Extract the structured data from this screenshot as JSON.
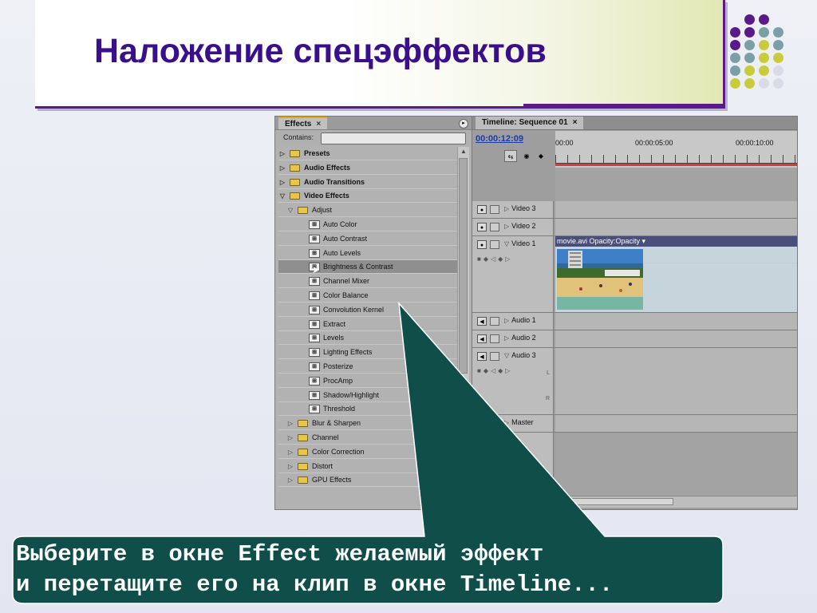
{
  "slide": {
    "title": "Наложение спецэффектов",
    "caption_line1": "Выберите в окне Effect желаемый эффект",
    "caption_line2": "и перетащите его на клип в окне Timeline...",
    "colors": {
      "title": "#3a0f8c",
      "accent": "#5a1a8a",
      "callout": "#0f4e49"
    }
  },
  "effects_panel": {
    "tab_label": "Effects",
    "close_glyph": "×",
    "contains_label": "Contains:",
    "contains_value": "",
    "tree": [
      {
        "label": "Presets",
        "kind": "folder",
        "level": 0,
        "bold": true,
        "expanded": false
      },
      {
        "label": "Audio Effects",
        "kind": "folder",
        "level": 0,
        "bold": true,
        "expanded": false
      },
      {
        "label": "Audio Transitions",
        "kind": "folder",
        "level": 0,
        "bold": true,
        "expanded": false
      },
      {
        "label": "Video Effects",
        "kind": "folder",
        "level": 0,
        "bold": true,
        "expanded": true
      },
      {
        "label": "Adjust",
        "kind": "folder",
        "level": 1,
        "bold": false,
        "expanded": true
      },
      {
        "label": "Auto Color",
        "kind": "effect",
        "level": 2
      },
      {
        "label": "Auto Contrast",
        "kind": "effect",
        "level": 2
      },
      {
        "label": "Auto Levels",
        "kind": "effect",
        "level": 2
      },
      {
        "label": "Brightness & Contrast",
        "kind": "effect",
        "level": 2,
        "selected": true
      },
      {
        "label": "Channel Mixer",
        "kind": "effect",
        "level": 2
      },
      {
        "label": "Color Balance",
        "kind": "effect",
        "level": 2
      },
      {
        "label": "Convolution Kernel",
        "kind": "effect",
        "level": 2
      },
      {
        "label": "Extract",
        "kind": "effect",
        "level": 2
      },
      {
        "label": "Levels",
        "kind": "effect",
        "level": 2
      },
      {
        "label": "Lighting Effects",
        "kind": "effect",
        "level": 2
      },
      {
        "label": "Posterize",
        "kind": "effect",
        "level": 2
      },
      {
        "label": "ProcAmp",
        "kind": "effect",
        "level": 2
      },
      {
        "label": "Shadow/Highlight",
        "kind": "effect",
        "level": 2
      },
      {
        "label": "Threshold",
        "kind": "effect",
        "level": 2
      },
      {
        "label": "Blur & Sharpen",
        "kind": "folder",
        "level": 1,
        "bold": false,
        "expanded": false
      },
      {
        "label": "Channel",
        "kind": "folder",
        "level": 1,
        "bold": false,
        "expanded": false
      },
      {
        "label": "Color Correction",
        "kind": "folder",
        "level": 1,
        "bold": false,
        "expanded": false
      },
      {
        "label": "Distort",
        "kind": "folder",
        "level": 1,
        "bold": false,
        "expanded": false
      },
      {
        "label": "GPU Effects",
        "kind": "folder",
        "level": 1,
        "bold": false,
        "expanded": false
      }
    ]
  },
  "timeline_panel": {
    "tab_label": "Timeline: Sequence 01",
    "close_glyph": "×",
    "timecode": "00:00:12:09",
    "ruler_labels": [
      "00:00",
      "00:00:05:00",
      "00:00:10:00"
    ],
    "tracks": {
      "video3": "Video 3",
      "video2": "Video 2",
      "video1": "Video 1",
      "audio1": "Audio 1",
      "audio2": "Audio 2",
      "audio3": "Audio 3",
      "master": "Master"
    },
    "clip_label": "movie.avi",
    "clip_opacity": "Opacity:Opacity ▾",
    "channel_l": "L",
    "channel_r": "R"
  }
}
